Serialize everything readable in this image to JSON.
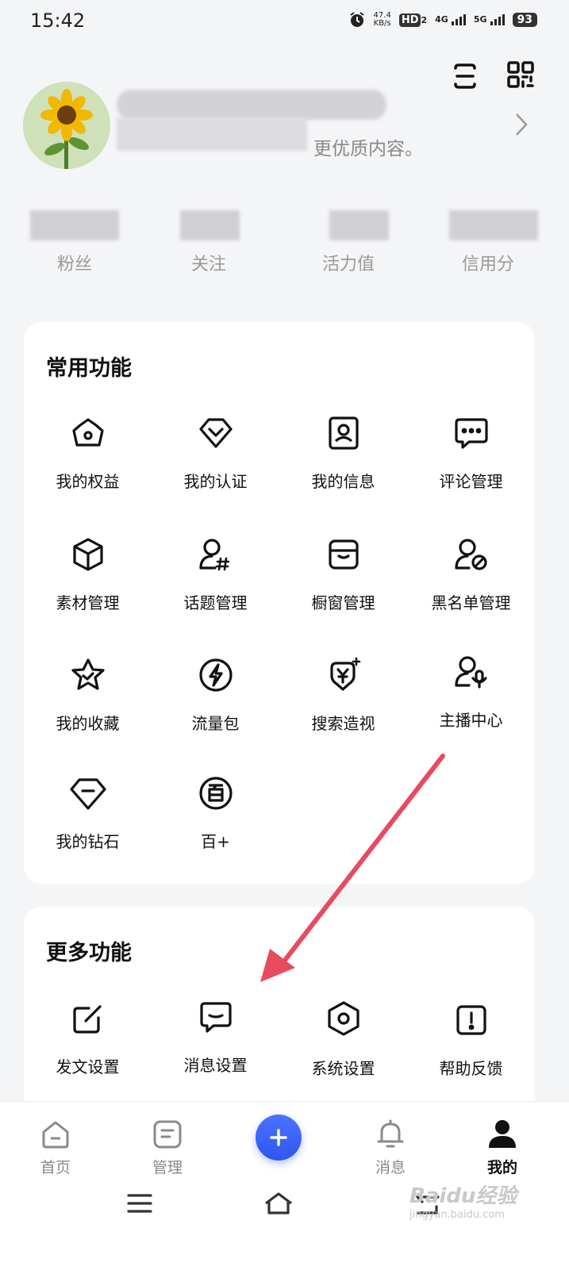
{
  "status_bar": {
    "time": "15:42",
    "net_speed_top": "47.4",
    "net_speed_bottom": "KB/s",
    "hd_label": "HD",
    "hd_sub": "2",
    "sig1_label": "4G",
    "sig2_label": "5G",
    "battery": "93"
  },
  "profile": {
    "subtitle": "更优质内容。"
  },
  "stats": [
    {
      "label": "粉丝"
    },
    {
      "label": "关注"
    },
    {
      "label": "活力值"
    },
    {
      "label": "信用分"
    }
  ],
  "common": {
    "title": "常用功能",
    "items": [
      {
        "label": "我的权益",
        "icon": "crown-icon"
      },
      {
        "label": "我的认证",
        "icon": "verified-badge-icon"
      },
      {
        "label": "我的信息",
        "icon": "profile-card-icon"
      },
      {
        "label": "评论管理",
        "icon": "comment-bubble-icon"
      },
      {
        "label": "素材管理",
        "icon": "cube-icon"
      },
      {
        "label": "话题管理",
        "icon": "user-hashtag-icon"
      },
      {
        "label": "橱窗管理",
        "icon": "storefront-icon"
      },
      {
        "label": "黑名单管理",
        "icon": "user-blocked-icon"
      },
      {
        "label": "我的收藏",
        "icon": "star-check-icon"
      },
      {
        "label": "流量包",
        "icon": "lightning-icon"
      },
      {
        "label": "搜索造视",
        "icon": "yuan-sparkle-icon"
      },
      {
        "label": "主播中心",
        "icon": "user-mic-icon"
      },
      {
        "label": "我的钻石",
        "icon": "diamond-icon"
      },
      {
        "label": "百+",
        "icon": "bai-circle-icon"
      }
    ]
  },
  "more": {
    "title": "更多功能",
    "items": [
      {
        "label": "发文设置",
        "icon": "edit-square-icon"
      },
      {
        "label": "消息设置",
        "icon": "message-settings-icon"
      },
      {
        "label": "系统设置",
        "icon": "hexagon-gear-icon"
      },
      {
        "label": "帮助反馈",
        "icon": "help-exclamation-icon"
      }
    ]
  },
  "bottom_nav": {
    "items": [
      {
        "label": "首页",
        "icon": "home-icon"
      },
      {
        "label": "管理",
        "icon": "manage-icon"
      },
      {
        "label": "消息",
        "icon": "bell-icon"
      },
      {
        "label": "我的",
        "icon": "person-icon",
        "active": true
      }
    ]
  },
  "watermark": {
    "text": "Baidu经验",
    "url_text": "jingyan.baidu.com"
  },
  "colors": {
    "accent": "#3a5ef5",
    "annotation_arrow": "#e84a5f",
    "background": "#f4f5f7"
  }
}
